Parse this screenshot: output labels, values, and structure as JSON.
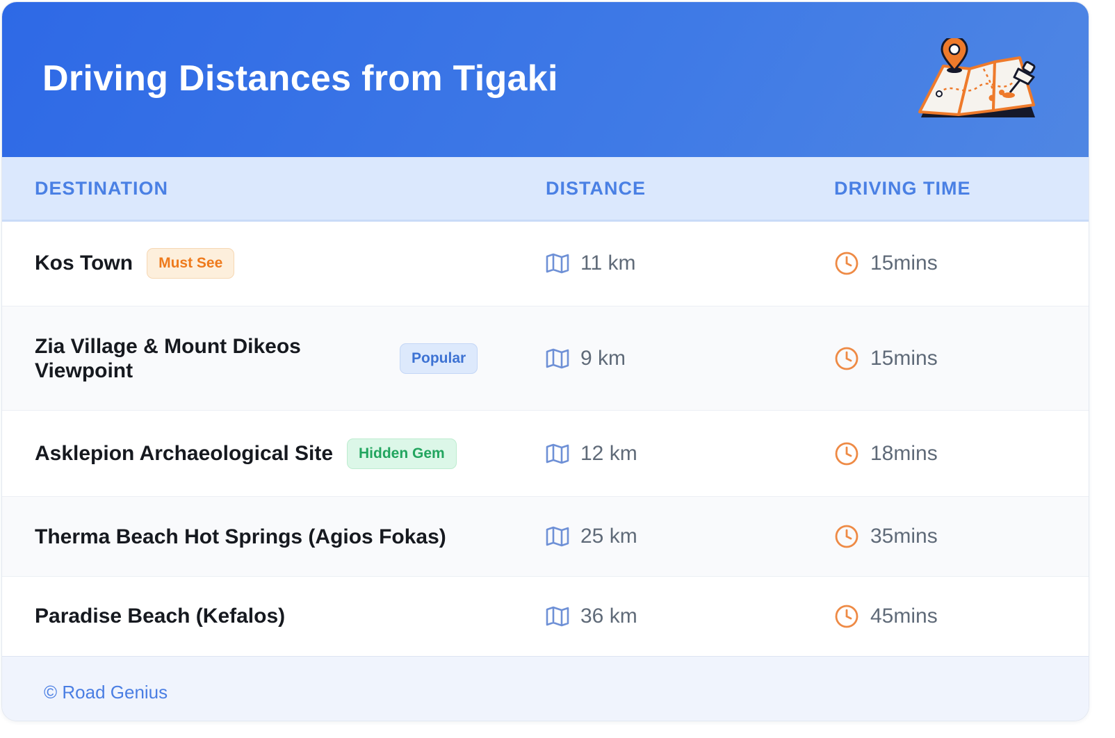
{
  "header": {
    "title": "Driving Distances from Tigaki",
    "illustration": "folded-map-with-pins-icon"
  },
  "table": {
    "columns": [
      "DESTINATION",
      "DISTANCE",
      "DRIVING TIME"
    ],
    "rows": [
      {
        "destination": "Kos Town",
        "badge": "Must See",
        "distance": "11 km",
        "time": "15mins"
      },
      {
        "destination": "Zia Village & Mount Dikeos Viewpoint",
        "badge": "Popular",
        "distance": "9 km",
        "time": "15mins"
      },
      {
        "destination": "Asklepion Archaeological Site",
        "badge": "Hidden Gem",
        "distance": "12 km",
        "time": "18mins"
      },
      {
        "destination": "Therma Beach Hot Springs (Agios Fokas)",
        "badge": null,
        "distance": "25 km",
        "time": "35mins"
      },
      {
        "destination": "Paradise Beach (Kefalos)",
        "badge": null,
        "distance": "36 km",
        "time": "45mins"
      }
    ],
    "icons": {
      "distance": "map-icon",
      "time": "clock-icon"
    }
  },
  "footer": {
    "text": "© Road Genius"
  },
  "colors": {
    "header_start": "#2e69e6",
    "header_end": "#4f86e3",
    "table_header_bg": "#dbe8fd",
    "table_header_text": "#4a80e4",
    "map_icon": "#6e90d6",
    "clock_icon": "#ee8a45",
    "badge_must_see": "#ee7a1c",
    "badge_popular": "#3d72d3",
    "badge_hidden_gem": "#22a55f"
  }
}
